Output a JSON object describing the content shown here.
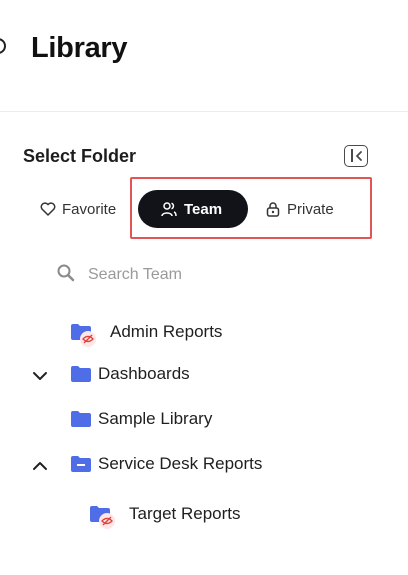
{
  "header": {
    "title": "Library"
  },
  "panel": {
    "title": "Select Folder",
    "tabs": [
      {
        "label": "Favorite",
        "icon": "heart-icon"
      },
      {
        "label": "Team",
        "icon": "users-icon",
        "selected": true
      },
      {
        "label": "Private",
        "icon": "lock-icon"
      }
    ],
    "search": {
      "placeholder": "Search Team",
      "value": ""
    }
  },
  "tree": [
    {
      "label": "Admin Reports",
      "icon": "folder-hidden-icon"
    },
    {
      "label": "Dashboards",
      "icon": "folder-icon",
      "chevron": "down"
    },
    {
      "label": "Sample Library",
      "icon": "folder-icon"
    },
    {
      "label": "Service Desk Reports",
      "icon": "folder-minus-icon",
      "chevron": "up"
    },
    {
      "label": "Target Reports",
      "icon": "folder-hidden-icon"
    }
  ],
  "colors": {
    "accent": "#4f6de6",
    "selected_tab_bg": "#111318",
    "highlight": "#e25555",
    "hidden_badge": "#e0403c"
  }
}
